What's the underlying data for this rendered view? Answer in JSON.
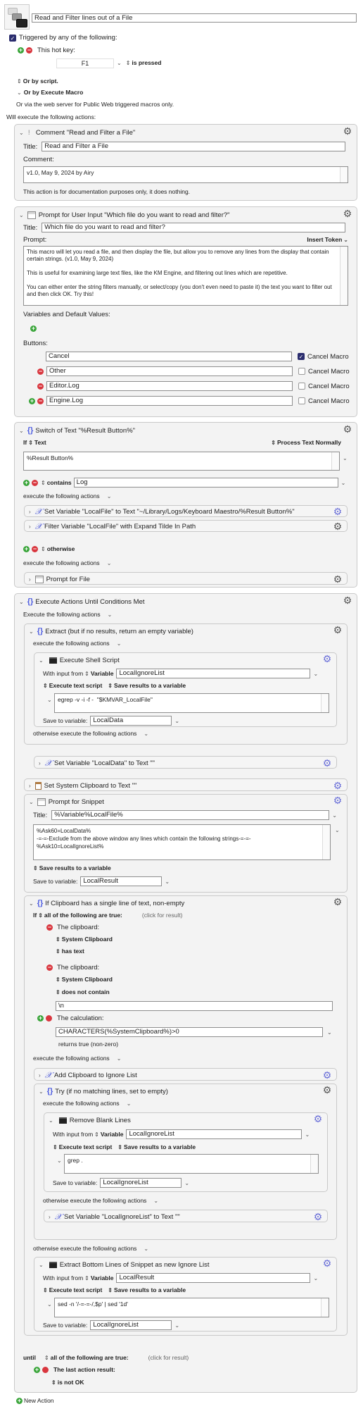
{
  "macro": {
    "name": "Read and Filter lines out of a File",
    "triggered_label": "Triggered by any of the following:",
    "hotkey_label": "This hot key:",
    "hotkey_value": "F1",
    "hotkey_condition": "is pressed",
    "or_by_script": "Or by script.",
    "or_by_execute_macro": "Or by Execute Macro",
    "web_server_note": "Or via the web server for Public Web triggered macros only.",
    "will_execute": "Will execute the following actions:"
  },
  "comment_action": {
    "header": "Comment \"Read and Filter a File\"",
    "title_label": "Title:",
    "title_value": "Read and Filter a File",
    "comment_label": "Comment:",
    "comment_value": "v1.0, May 9, 2024 by Airy",
    "note": "This action is for documentation purposes only, it does nothing."
  },
  "prompt_action": {
    "header": "Prompt for User Input \"Which file do you want to read and filter?\"",
    "title_label": "Title:",
    "title_value": "Which file do you want to read and filter?",
    "prompt_label": "Prompt:",
    "insert_token": "Insert Token",
    "prompt_value": "This macro will let you read a file, and then display the file, but allow you to remove any lines from the display that contain certain strings. (v1.0, May 9, 2024)\n\nThis is useful for examining large text files, like the KM Engine, and filtering out lines which are repetitive.\n\nYou can either enter the string filters manually, or select/copy (you don't even need to paste it) the text you want to filter out and then click OK. Try this!",
    "variables_label": "Variables and Default Values:",
    "buttons_label": "Buttons:",
    "cancel_macro_label": "Cancel Macro",
    "buttons": [
      {
        "label": "Cancel",
        "cancel_macro": true
      },
      {
        "label": "Other",
        "cancel_macro": false
      },
      {
        "label": "Editor.Log",
        "cancel_macro": false
      },
      {
        "label": "Engine.Log",
        "cancel_macro": false
      }
    ]
  },
  "switch_action": {
    "header": "Switch of Text \"%Result Button%\"",
    "if_label": "If",
    "if_type": "Text",
    "process_text": "Process Text Normally",
    "text_value": "%Result Button%",
    "contains_label": "contains",
    "contains_value": "Log",
    "execute_label": "execute the following actions",
    "case_actions": [
      "Set Variable \"LocalFile\" to Text \"~/Library/Logs/Keyboard Maestro/%Result Button%\"",
      "Filter Variable \"LocalFile\" with Expand Tilde In Path"
    ],
    "otherwise_label": "otherwise",
    "otherwise_execute_label": "execute the following actions",
    "otherwise_action": "Prompt for File"
  },
  "until_action": {
    "header": "Execute Actions Until Conditions Met",
    "execute_label": "Execute the following actions",
    "extract": {
      "header": "Extract (but if no results, return an empty variable)",
      "execute_label": "execute the following actions",
      "shell": {
        "header": "Execute Shell Script",
        "with_input_label": "With input from",
        "input_type": "Variable",
        "input_value": "LocalIgnoreList",
        "execute_mode": "Execute text script",
        "save_mode": "Save results to a variable",
        "script": "egrep -v -i -f -  \"$KMVAR_LocalFile\"",
        "save_label": "Save to variable:",
        "save_value": "LocalData"
      },
      "otherwise_label": "otherwise execute the following actions",
      "otherwise_action": "Set Variable \"LocalData\" to Text \"\""
    },
    "set_clipboard": "Set System Clipboard to Text \"\"",
    "snippet": {
      "header": "Prompt for Snippet",
      "title_label": "Title:",
      "title_value": "%Variable%LocalFile%",
      "body": "%Ask60=LocalData%\n-=-=-Exclude from the above window any lines which contain the following strings-=-=-\n%Ask10=LocalIgnoreList%",
      "save_mode": "Save results to a variable",
      "save_label": "Save to variable:",
      "save_value": "LocalResult"
    },
    "if_clipboard": {
      "header": "If Clipboard has a single line of text, non-empty",
      "if_label": "If",
      "condition_mode": "all of the following are true:",
      "click_for_result": "(click for result)",
      "cond1_label": "The clipboard:",
      "cond1_source": "System Clipboard",
      "cond1_test": "has text",
      "cond2_label": "The clipboard:",
      "cond2_source": "System Clipboard",
      "cond2_test": "does not contain",
      "cond2_value": "\\n",
      "cond3_label": "The calculation:",
      "cond3_value": "CHARACTERS(%SystemClipboard%)>0",
      "cond3_result": "returns true (non-zero)",
      "execute_label": "execute the following actions",
      "add_clipboard": "Add Clipboard to Ignore List",
      "try": {
        "header": "Try (if no matching lines, set to empty)",
        "execute_label": "execute the following actions",
        "shell": {
          "header": "Remove Blank Lines",
          "with_input_label": "With input from",
          "input_type": "Variable",
          "input_value": "LocalIgnoreList",
          "execute_mode": "Execute text script",
          "save_mode": "Save results to a variable",
          "script": "grep .",
          "save_label": "Save to variable:",
          "save_value": "LocalIgnoreList"
        },
        "otherwise_label": "otherwise execute the following actions",
        "otherwise_action": "Set Variable \"LocalIgnoreList\" to Text \"\""
      },
      "otherwise_label": "otherwise execute the following actions",
      "otherwise_shell": {
        "header": "Extract Bottom Lines of Snippet as new Ignore List",
        "with_input_label": "With input from",
        "input_type": "Variable",
        "input_value": "LocalResult",
        "execute_mode": "Execute text script",
        "save_mode": "Save results to a variable",
        "script": "sed -n '/-=-=-/,$p' | sed '1d'",
        "save_label": "Save to variable:",
        "save_value": "LocalIgnoreList"
      }
    },
    "until_label": "until",
    "until_mode": "all of the following are true:",
    "click_for_result": "(click for result)",
    "until_cond_label": "The last action result:",
    "until_cond_test": "is not OK"
  },
  "new_action": "New Action"
}
